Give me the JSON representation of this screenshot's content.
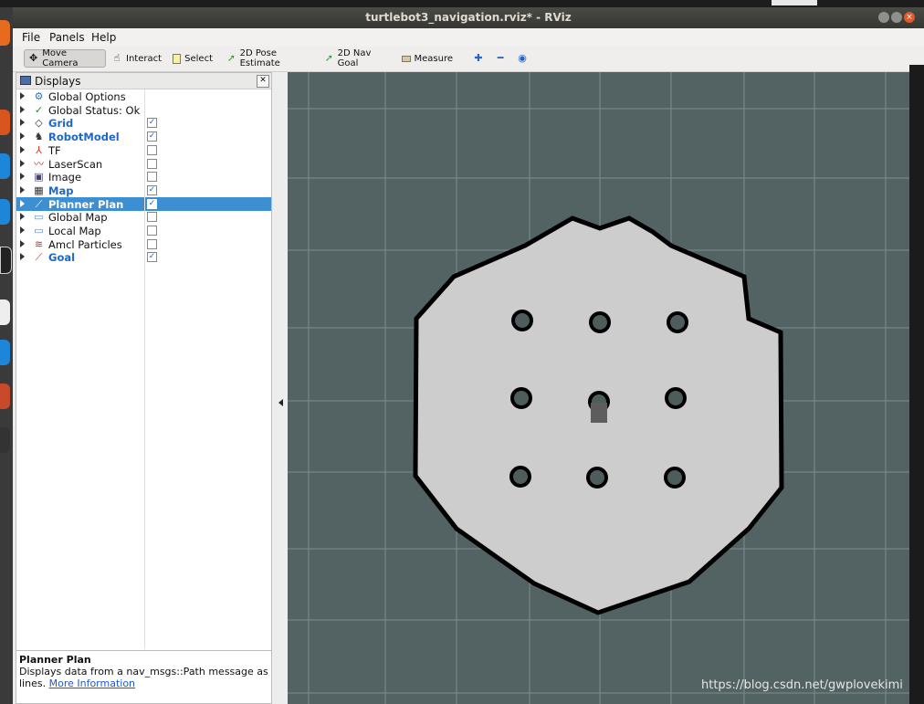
{
  "window": {
    "title": "turtlebot3_navigation.rviz* - RViz"
  },
  "menubar": {
    "items": [
      "File",
      "Panels",
      "Help"
    ]
  },
  "toolbar": {
    "tools": [
      {
        "label": "Move Camera",
        "icon": "move-camera-icon",
        "active": true
      },
      {
        "label": "Interact",
        "icon": "hand-icon",
        "active": false
      },
      {
        "label": "Select",
        "icon": "select-icon",
        "active": false
      },
      {
        "label": "2D Pose Estimate",
        "icon": "pose-arrow-icon",
        "active": false
      },
      {
        "label": "2D Nav Goal",
        "icon": "goal-arrow-icon",
        "active": false
      },
      {
        "label": "Measure",
        "icon": "ruler-icon",
        "active": false
      }
    ]
  },
  "displays": {
    "title": "Displays",
    "items": [
      {
        "label": "Global Options",
        "icon": "gear-icon",
        "checkbox": false,
        "checked": false,
        "enabled": false
      },
      {
        "label": "Global Status: Ok",
        "icon": "checkmark-icon",
        "checkbox": false,
        "checked": false,
        "enabled": false
      },
      {
        "label": "Grid",
        "icon": "grid-icon",
        "checkbox": true,
        "checked": true,
        "enabled": true
      },
      {
        "label": "RobotModel",
        "icon": "robot-icon",
        "checkbox": true,
        "checked": true,
        "enabled": true
      },
      {
        "label": "TF",
        "icon": "tf-axes-icon",
        "checkbox": true,
        "checked": false,
        "enabled": false
      },
      {
        "label": "LaserScan",
        "icon": "laserscan-icon",
        "checkbox": true,
        "checked": false,
        "enabled": false
      },
      {
        "label": "Image",
        "icon": "image-icon",
        "checkbox": true,
        "checked": false,
        "enabled": false
      },
      {
        "label": "Map",
        "icon": "map-icon",
        "checkbox": true,
        "checked": true,
        "enabled": true
      },
      {
        "label": "Planner Plan",
        "icon": "path-icon",
        "checkbox": true,
        "checked": true,
        "enabled": true,
        "selected": true
      },
      {
        "label": "Global Map",
        "icon": "folder-icon",
        "checkbox": true,
        "checked": false,
        "enabled": false
      },
      {
        "label": "Local Map",
        "icon": "folder-icon",
        "checkbox": true,
        "checked": false,
        "enabled": false
      },
      {
        "label": "Amcl Particles",
        "icon": "particles-icon",
        "checkbox": true,
        "checked": false,
        "enabled": false
      },
      {
        "label": "Goal",
        "icon": "goal-arrow-icon",
        "checkbox": true,
        "checked": true,
        "enabled": true
      }
    ]
  },
  "help": {
    "title": "Planner Plan",
    "text": "Displays data from a nav_msgs::Path message as lines.",
    "link": "More Information"
  },
  "watermark": "https://blog.csdn.net/gwplovekimi",
  "colors": {
    "view_bg": "#536262",
    "map_free": "#cdcdcd",
    "map_wall": "#000000",
    "selection": "#3d8fd1",
    "enabled_text": "#1f67c8"
  }
}
